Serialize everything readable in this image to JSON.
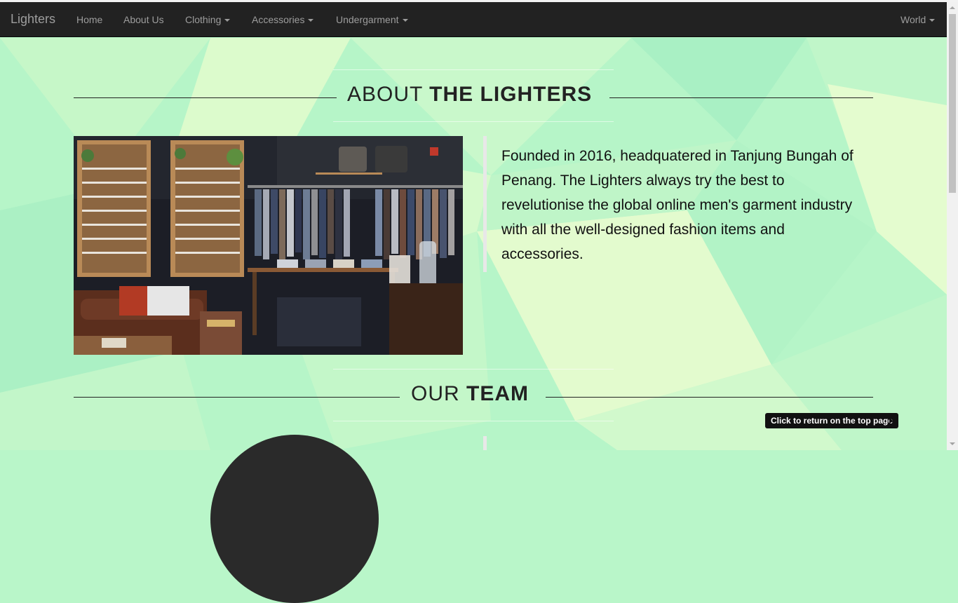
{
  "navbar": {
    "brand": "Lighters",
    "items": [
      {
        "label": "Home",
        "dropdown": false
      },
      {
        "label": "About Us",
        "dropdown": false
      },
      {
        "label": "Clothing",
        "dropdown": true
      },
      {
        "label": "Accessories",
        "dropdown": true
      },
      {
        "label": "Undergarment",
        "dropdown": true
      }
    ],
    "right_item": {
      "label": "World",
      "dropdown": true
    }
  },
  "about": {
    "heading_light": "ABOUT",
    "heading_bold": "THE LIGHTERS",
    "text": "Founded in 2016, headquatered in Tanjung Bungah of Penang. The Lighters always try the best to revelutionise the global online men's garment industry with all the well-designed fashion items and accessories."
  },
  "team": {
    "heading_light": "OUR",
    "heading_bold": "TEAM"
  },
  "tooltip": {
    "text": "Click to return on the top page"
  },
  "colors": {
    "navbar_bg": "#222222",
    "nav_text": "#9d9d9d",
    "page_bg": "#b9f6c9",
    "pattern_light": "#e6fccf",
    "tooltip_bg": "#111111"
  }
}
